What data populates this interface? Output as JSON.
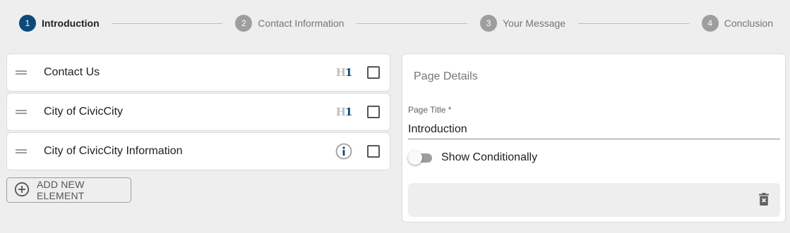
{
  "stepper": {
    "steps": [
      {
        "number": "1",
        "label": "Introduction"
      },
      {
        "number": "2",
        "label": "Contact Information"
      },
      {
        "number": "3",
        "label": "Your Message"
      },
      {
        "number": "4",
        "label": "Conclusion"
      }
    ]
  },
  "elements": {
    "items": [
      {
        "label": "Contact Us",
        "type_icon": "h1-icon",
        "checked": false
      },
      {
        "label": "City of CivicCity",
        "type_icon": "h1-icon",
        "checked": false
      },
      {
        "label": "City of CivicCity Information",
        "type_icon": "info-icon",
        "checked": false
      }
    ],
    "add_button_label": "ADD NEW ELEMENT",
    "add_button_icon": "add-circle-icon"
  },
  "details": {
    "title": "Page Details",
    "page_title_label": "Page Title *",
    "page_title_value": "Introduction",
    "show_conditionally_label": "Show Conditionally",
    "show_conditionally_on": false,
    "delete_icon": "delete-icon"
  },
  "colors": {
    "accent": "#0d4a7a",
    "inactive_step": "#9e9e9e",
    "background": "#eeeeee"
  }
}
